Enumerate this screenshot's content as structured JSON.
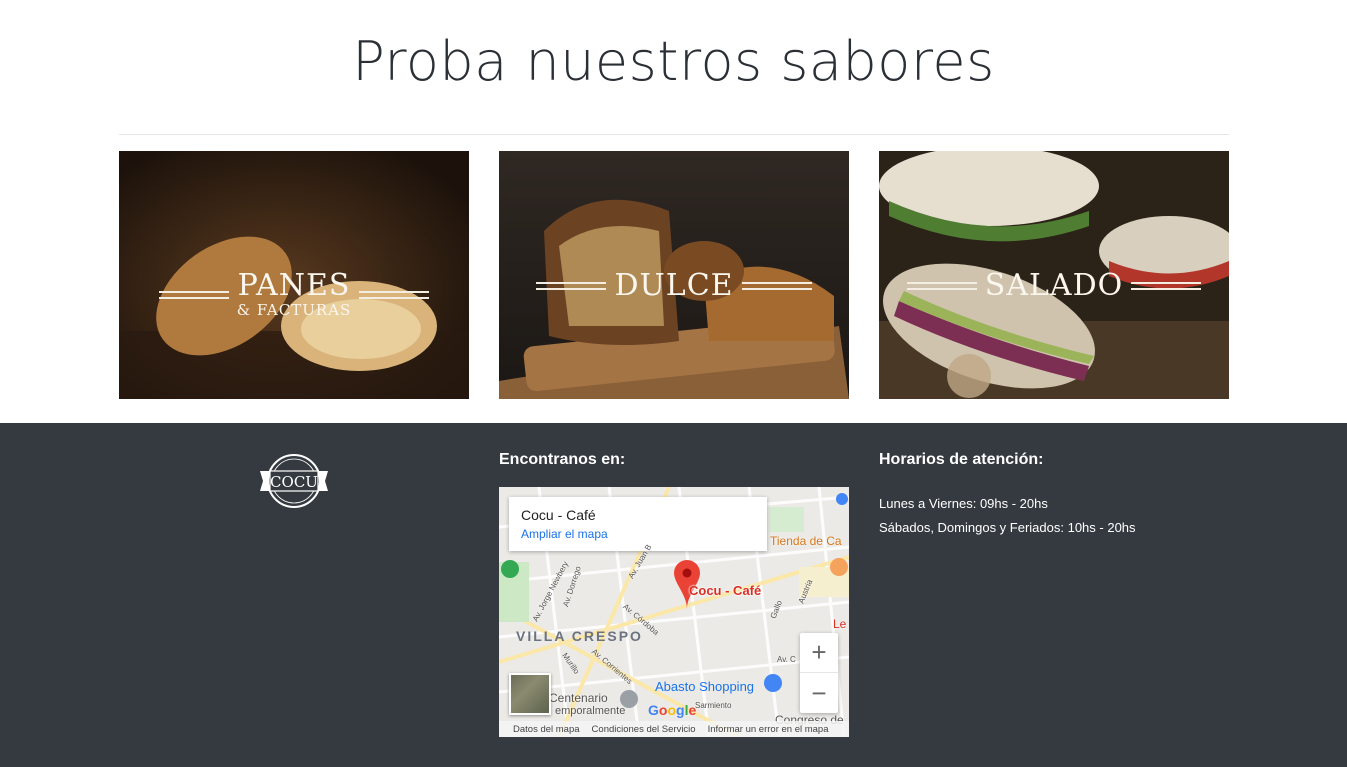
{
  "heading": "Proba nuestros sabores",
  "cards": [
    {
      "big": "PANES",
      "small": "& FACTURAS"
    },
    {
      "big": "DULCE",
      "small": ""
    },
    {
      "big": "SALADO",
      "small": ""
    }
  ],
  "footer": {
    "logo_text": "COCU",
    "find_title": "Encontranos en:",
    "hours_title": "Horarios de atención:",
    "hours": [
      "Lunes a Viernes: 09hs - 20hs",
      "Sábados, Domingos y Feriados: 10hs - 20hs"
    ]
  },
  "map": {
    "place_name": "Cocu - Café",
    "enlarge_link": "Ampliar el mapa",
    "pin_label": "Cocu - Café",
    "area_label": "VILLA CRESPO",
    "landmark_abasto": "Abasto Shopping",
    "landmark_tienda": "Tienda de Ca",
    "landmark_centenario": "Centenario",
    "landmark_temporal": "emporalmente",
    "street_le": "Le",
    "streets": [
      "Av. Jorge Newbery",
      "Av. Dorrego",
      "Av. Juan B",
      "Av. Córdoba",
      "Av. Corrientes",
      "Murillo",
      "Gallo",
      "Austria",
      "Av. C",
      "Sarmiento"
    ],
    "congreso": "Congreso de",
    "logo": "Google",
    "zoom_in": "+",
    "zoom_out": "−",
    "attrib": [
      "Datos del mapa",
      "Condiciones del Servicio",
      "Informar un error en el mapa"
    ],
    "colors": {
      "pin": "#ea4335",
      "link": "#1a73e8"
    }
  }
}
